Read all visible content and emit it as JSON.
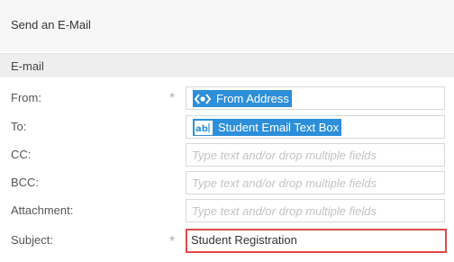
{
  "header": {
    "title": "Send an E-Mail"
  },
  "section": {
    "title": "E-mail"
  },
  "fields": {
    "from": {
      "label": "From:",
      "chip_label": "From Address",
      "chip_icon": "variable-icon",
      "required": true
    },
    "to": {
      "label": "To:",
      "chip_label": "Student Email Text Box",
      "chip_icon": "text-box-icon",
      "chip_icon_text": "ab"
    },
    "cc": {
      "label": "CC:",
      "placeholder": "Type text and/or drop multiple fields"
    },
    "bcc": {
      "label": "BCC:",
      "placeholder": "Type text and/or drop multiple fields"
    },
    "attachment": {
      "label": "Attachment:",
      "placeholder": "Type text and/or drop multiple fields"
    },
    "subject": {
      "label": "Subject:",
      "value": "Student Registration",
      "required": true
    }
  },
  "colors": {
    "chip": "#2d8fd9",
    "highlight": "#e04848",
    "required_star": "#b0b0b0"
  }
}
